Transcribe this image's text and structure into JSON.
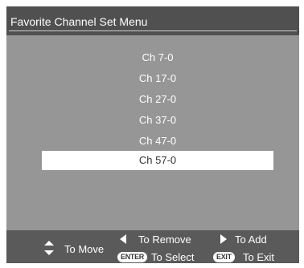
{
  "menu": {
    "title": "Favorite Channel Set Menu",
    "channels": [
      {
        "label": "Ch 7-0",
        "selected": false
      },
      {
        "label": "Ch 17-0",
        "selected": false
      },
      {
        "label": "Ch 27-0",
        "selected": false
      },
      {
        "label": "Ch 37-0",
        "selected": false
      },
      {
        "label": "Ch 47-0",
        "selected": false
      },
      {
        "label": "Ch 57-0",
        "selected": true
      }
    ]
  },
  "footer": {
    "move": {
      "icon": "up-down-arrows-icon",
      "label": "To Move"
    },
    "remove": {
      "icon": "left-arrow-icon",
      "label": "To Remove"
    },
    "add": {
      "icon": "right-arrow-icon",
      "label": "To Add"
    },
    "select": {
      "key": "ENTER",
      "label": "To Select"
    },
    "exit": {
      "key": "EXIT",
      "label": "To Exit"
    }
  },
  "colors": {
    "panel": "#969696",
    "header": "#505050",
    "footer": "#5a5a5a",
    "highlight": "#ffffff",
    "text": "#ffffff"
  }
}
